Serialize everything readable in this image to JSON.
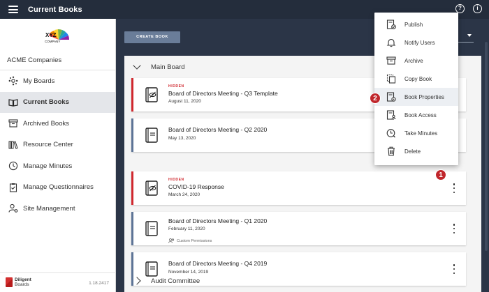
{
  "topbar": {
    "title": "Current Books",
    "help_icon": "question-circle-icon",
    "info_icon": "info-circle-icon"
  },
  "sidebar": {
    "logo_text": "XYZ",
    "logo_sub": "COMPANY",
    "company": "ACME Companies",
    "items": [
      {
        "label": "My Boards",
        "icon": "hub-icon",
        "active": false
      },
      {
        "label": "Current Books",
        "icon": "book-open-icon",
        "active": true
      },
      {
        "label": "Archived Books",
        "icon": "archive-icon",
        "active": false
      },
      {
        "label": "Resource Center",
        "icon": "library-icon",
        "active": false
      },
      {
        "label": "Manage Minutes",
        "icon": "clock-icon",
        "active": false
      },
      {
        "label": "Manage Questionnaires",
        "icon": "clipboard-check-icon",
        "active": false
      },
      {
        "label": "Site Management",
        "icon": "user-gear-icon",
        "active": false
      }
    ],
    "brand_line1": "Diligent",
    "brand_line2": "Boards",
    "version": "1.18.2417"
  },
  "main": {
    "create_label": "CREATE BOOK",
    "groups": [
      {
        "label": "Main Board",
        "expanded": true
      },
      {
        "label": "Audit Committee",
        "expanded": false
      }
    ],
    "books": [
      {
        "hidden_label": "HIDDEN",
        "title": "Board of Directors Meeting - Q3 Template",
        "date": "August 11, 2020",
        "permissions": ""
      },
      {
        "hidden_label": "",
        "title": "Board of Directors Meeting - Q2 2020",
        "date": "May 13, 2020",
        "permissions": ""
      },
      {
        "hidden_label": "HIDDEN",
        "title": "COVID-19 Response",
        "date": "March 24, 2020",
        "permissions": ""
      },
      {
        "hidden_label": "",
        "title": "Board of Directors Meeting - Q1 2020",
        "date": "February 11, 2020",
        "permissions": "Custom Permissions"
      },
      {
        "hidden_label": "",
        "title": "Board of Directors Meeting - Q4 2019",
        "date": "November 14, 2019",
        "permissions": ""
      }
    ]
  },
  "menu": {
    "items": [
      {
        "label": "Publish",
        "icon": "publish-icon"
      },
      {
        "label": "Notify Users",
        "icon": "bell-icon"
      },
      {
        "label": "Archive",
        "icon": "archive-icon"
      },
      {
        "label": "Copy Book",
        "icon": "copy-icon"
      },
      {
        "label": "Book Properties",
        "icon": "book-settings-icon",
        "highlighted": true
      },
      {
        "label": "Book Access",
        "icon": "book-user-icon"
      },
      {
        "label": "Take Minutes",
        "icon": "minutes-clock-icon"
      },
      {
        "label": "Delete",
        "icon": "trash-icon"
      }
    ]
  },
  "badges": {
    "step1": "1",
    "step2": "2"
  },
  "colors": {
    "topbar": "#242d3c",
    "accent_red": "#d0282e",
    "book_blue": "#5d7496",
    "button": "#6a7d99"
  }
}
